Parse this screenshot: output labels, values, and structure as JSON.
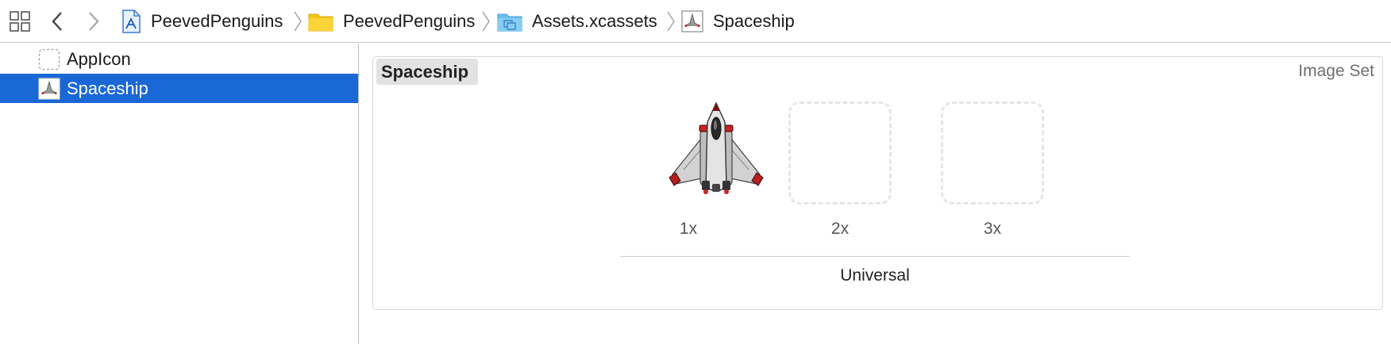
{
  "jumpbar": {
    "crumbs": [
      {
        "label": "PeevedPenguins",
        "icon": "xcode-project-icon"
      },
      {
        "label": "PeevedPenguins",
        "icon": "folder-icon"
      },
      {
        "label": "Assets.xcassets",
        "icon": "asset-catalog-icon"
      },
      {
        "label": "Spaceship",
        "icon": "image-set-icon"
      }
    ]
  },
  "sidebar": {
    "items": [
      {
        "label": "AppIcon",
        "icon": "app-icon-placeholder-icon",
        "selected": false
      },
      {
        "label": "Spaceship",
        "icon": "image-set-icon",
        "selected": true
      }
    ]
  },
  "editor": {
    "set_name": "Spaceship",
    "set_type": "Image Set",
    "slots": [
      {
        "label": "1x",
        "filled": true,
        "image": "spaceship-image"
      },
      {
        "label": "2x",
        "filled": false
      },
      {
        "label": "3x",
        "filled": false
      }
    ],
    "group_label": "Universal"
  },
  "colors": {
    "selection": "#1a68d6",
    "folder_yellow": "#f5c518",
    "catalog_blue": "#6ec0f2"
  }
}
